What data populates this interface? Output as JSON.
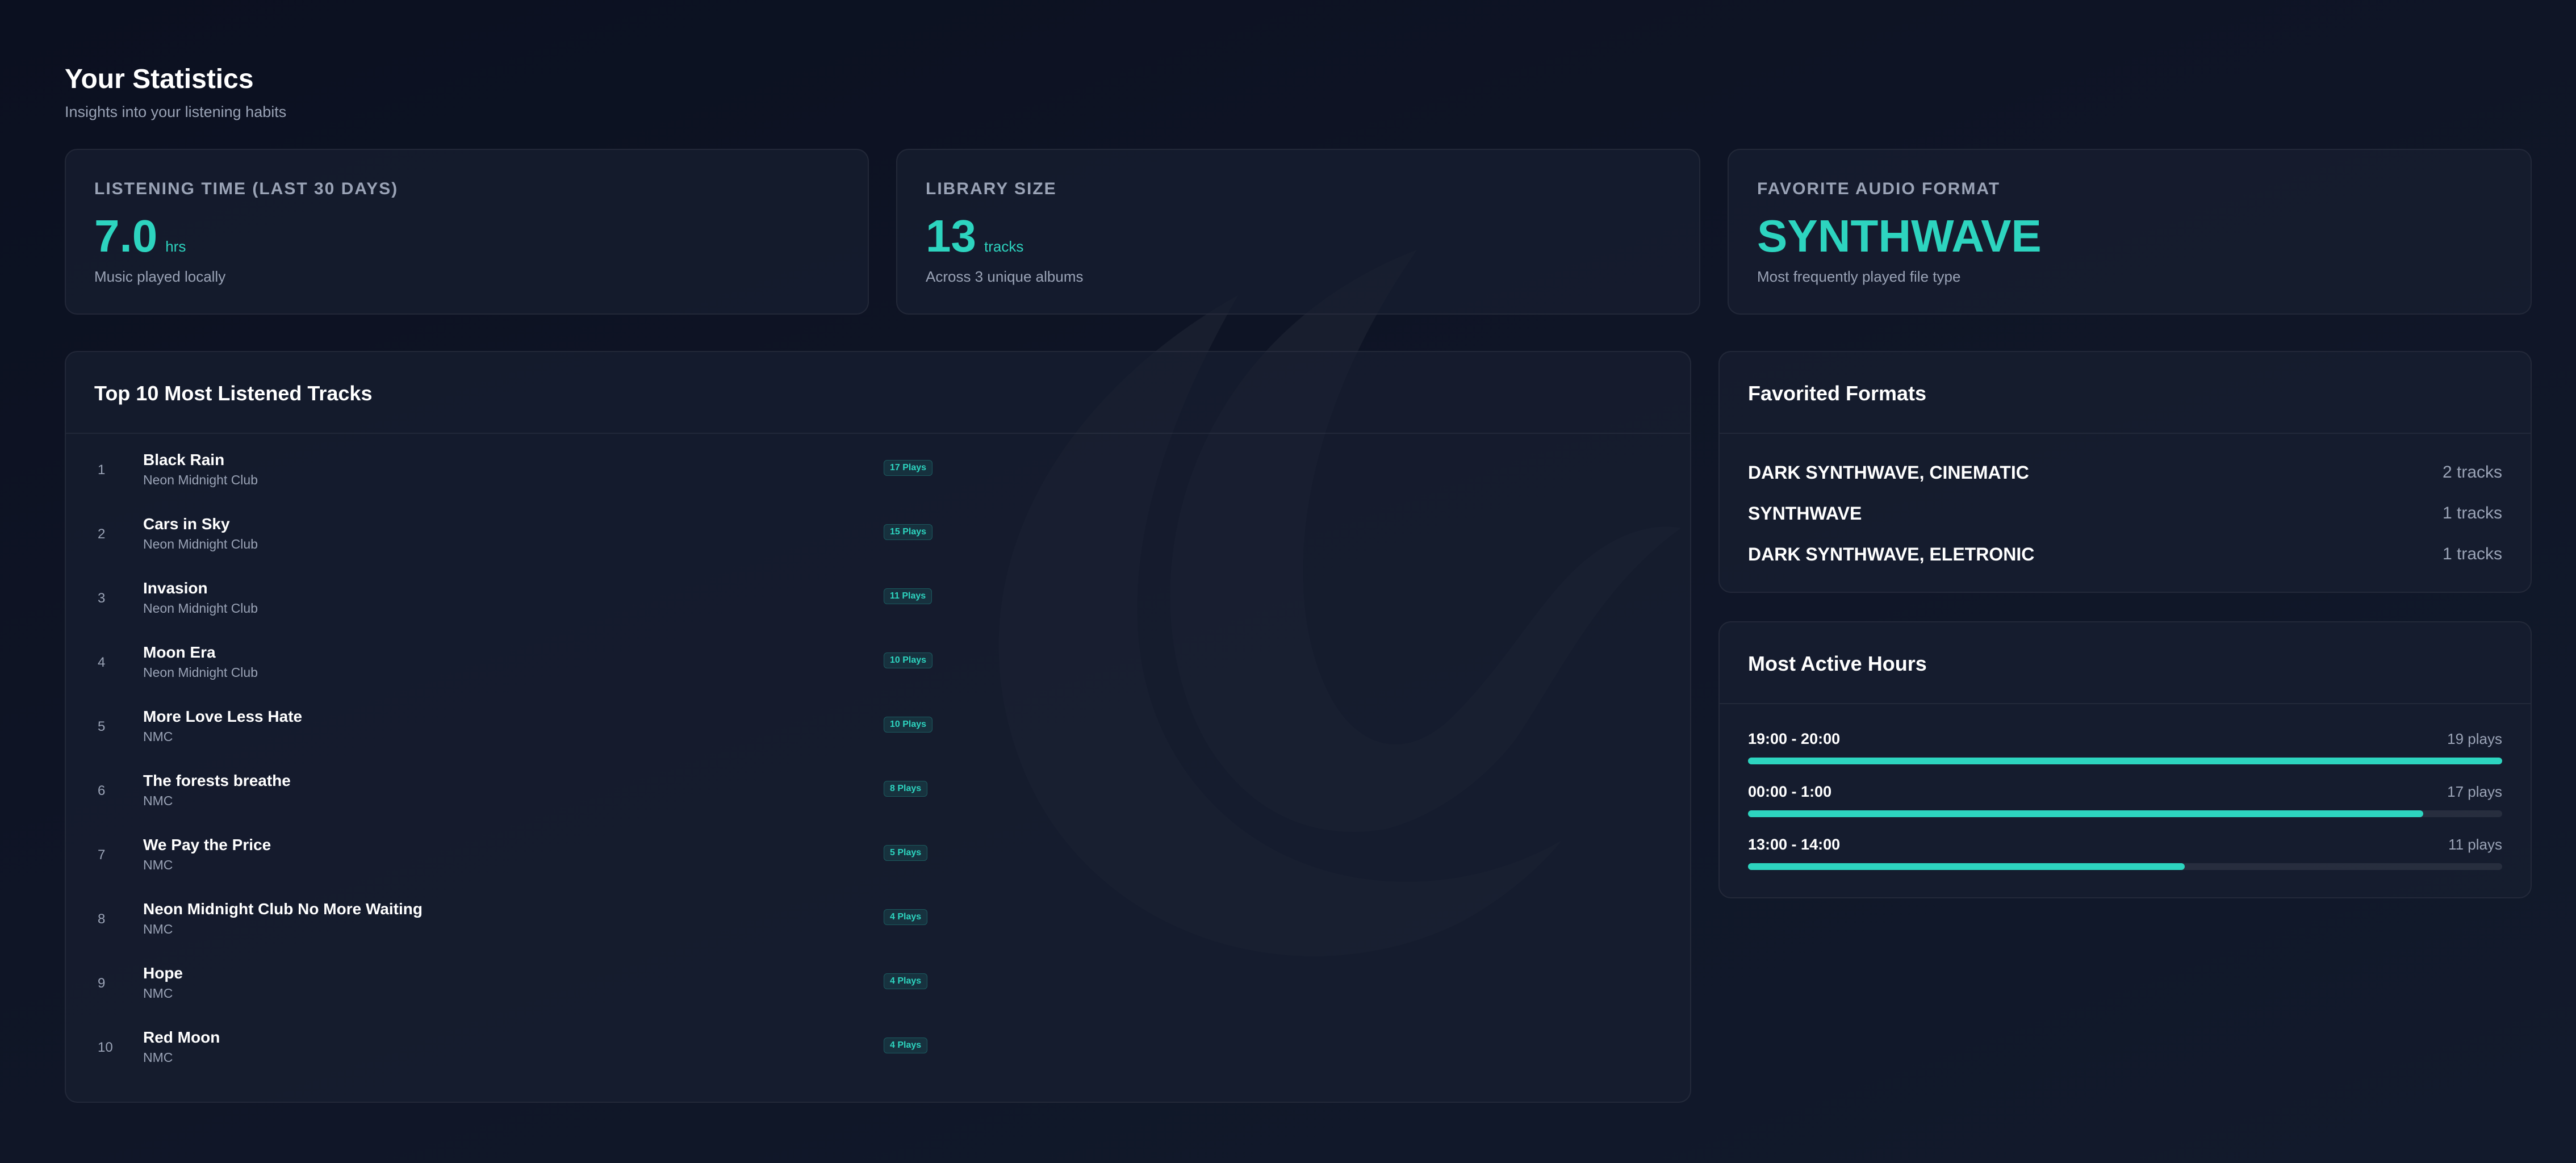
{
  "header": {
    "title": "Your Statistics",
    "subtitle": "Insights into your listening habits"
  },
  "stats": [
    {
      "label": "LISTENING TIME (LAST 30 DAYS)",
      "value": "7.0",
      "unit": "hrs",
      "note": "Music played locally"
    },
    {
      "label": "LIBRARY SIZE",
      "value": "13",
      "unit": "tracks",
      "note": "Across 3 unique albums"
    },
    {
      "label": "FAVORITE AUDIO FORMAT",
      "value": "SYNTHWAVE",
      "unit": "",
      "note": "Most frequently played file type"
    }
  ],
  "top_tracks": {
    "title": "Top 10 Most Listened Tracks",
    "items": [
      {
        "rank": "1",
        "title": "Black Rain",
        "artist": "Neon Midnight Club",
        "plays": "17 Plays"
      },
      {
        "rank": "2",
        "title": "Cars in Sky",
        "artist": "Neon Midnight Club",
        "plays": "15 Plays"
      },
      {
        "rank": "3",
        "title": "Invasion",
        "artist": "Neon Midnight Club",
        "plays": "11 Plays"
      },
      {
        "rank": "4",
        "title": "Moon Era",
        "artist": "Neon Midnight Club",
        "plays": "10 Plays"
      },
      {
        "rank": "5",
        "title": "More Love Less Hate",
        "artist": "NMC",
        "plays": "10 Plays"
      },
      {
        "rank": "6",
        "title": "The forests breathe",
        "artist": "NMC",
        "plays": "8 Plays"
      },
      {
        "rank": "7",
        "title": "We Pay the Price",
        "artist": "NMC",
        "plays": "5 Plays"
      },
      {
        "rank": "8",
        "title": "Neon Midnight Club No More Waiting",
        "artist": "NMC",
        "plays": "4 Plays"
      },
      {
        "rank": "9",
        "title": "Hope",
        "artist": "NMC",
        "plays": "4 Plays"
      },
      {
        "rank": "10",
        "title": "Red Moon",
        "artist": "NMC",
        "plays": "4 Plays"
      }
    ]
  },
  "favorited_formats": {
    "title": "Favorited Formats",
    "items": [
      {
        "name": "DARK SYNTHWAVE, CINEMATIC",
        "count": "2 tracks"
      },
      {
        "name": "SYNTHWAVE",
        "count": "1 tracks"
      },
      {
        "name": "DARK SYNTHWAVE, ELETRONIC",
        "count": "1 tracks"
      }
    ]
  },
  "active_hours": {
    "title": "Most Active Hours",
    "items": [
      {
        "range": "19:00 - 20:00",
        "plays": "19 plays",
        "fraction": 1.0
      },
      {
        "range": "00:00 - 1:00",
        "plays": "17 plays",
        "fraction": 0.895
      },
      {
        "range": "13:00 - 14:00",
        "plays": "11 plays",
        "fraction": 0.579
      }
    ]
  },
  "colors": {
    "accent": "#2dd4bf",
    "background": "#0f1526",
    "card": "#181f30",
    "muted_text": "#9aa3b6"
  },
  "icons": {
    "background_watermark": "moon-leaf-logo-icon"
  }
}
